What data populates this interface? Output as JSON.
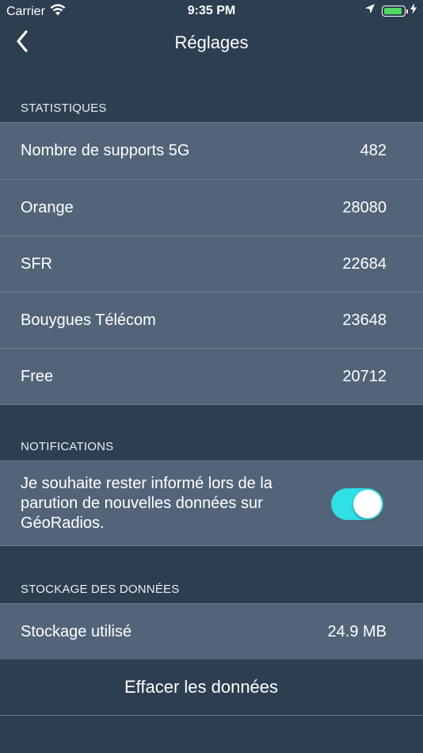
{
  "status_bar": {
    "carrier": "Carrier",
    "time": "9:35 PM",
    "battery_level": 1.0,
    "icons": [
      "wifi-icon",
      "location-arrow-icon",
      "battery-icon",
      "charging-bolt-icon"
    ]
  },
  "nav": {
    "title": "Réglages",
    "back_icon": "chevron-left-icon"
  },
  "statistics": {
    "header": "STATISTIQUES",
    "rows": [
      {
        "label": "Nombre de supports 5G",
        "value": "482"
      },
      {
        "label": "Orange",
        "value": "28080"
      },
      {
        "label": "SFR",
        "value": "22684"
      },
      {
        "label": "Bouygues Télécom",
        "value": "23648"
      },
      {
        "label": "Free",
        "value": "20712"
      }
    ]
  },
  "notifications": {
    "header": "NOTIFICATIONS",
    "text": "Je souhaite rester informé lors de la parution de nouvelles données sur GéoRadios.",
    "toggle_on": true
  },
  "storage": {
    "header": "STOCKAGE DES DONNÉES",
    "used_label": "Stockage utilisé",
    "used_value": "24.9 MB",
    "clear_label": "Effacer les données"
  },
  "colors": {
    "background": "#2d3e50",
    "row_background": "#536478",
    "separator": "#6a7b8e",
    "toggle_on": "#2fe0e6",
    "battery": "#4cd964"
  }
}
